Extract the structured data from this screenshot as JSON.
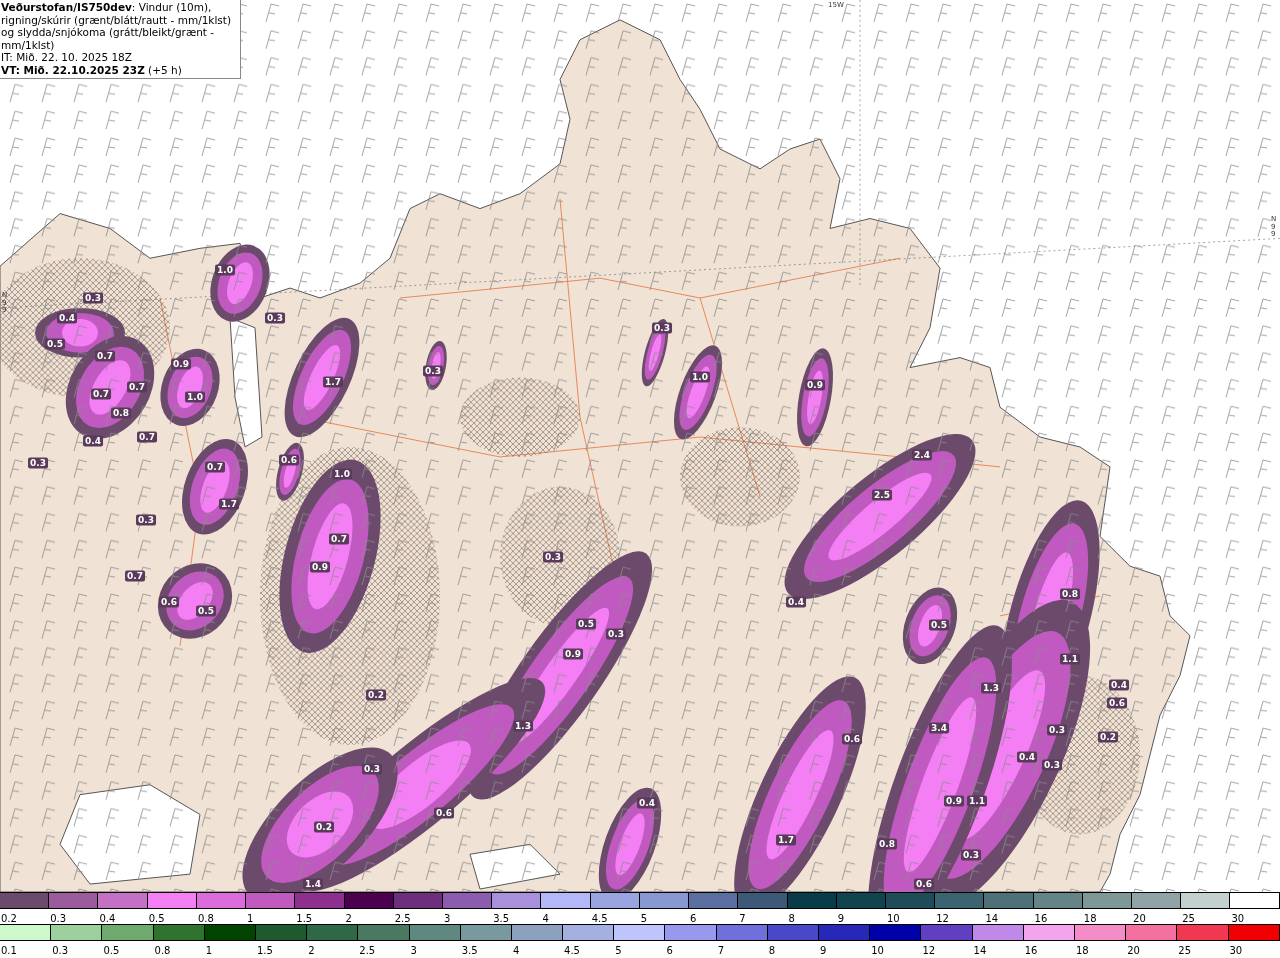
{
  "header": {
    "description": "**Veðurstofan/IS750dev**: Vindur (10m), rigning/skúrir (grænt/blátt/rautt - mm/1klst) og slydda/snjókoma (grátt/bleikt/grænt - mm/1klst)",
    "issue_time": "IT: Mið. 22. 10. 2025 18Z",
    "valid_time": "**VT: Mið. 22.10.2025 23Z** (+5 h)"
  },
  "map": {
    "grid_labels": [
      "15W",
      "N99",
      "N99"
    ],
    "contour_labels": [
      "1.0",
      "0.3",
      "0.4",
      "0.3",
      "0.5",
      "0.7",
      "0.7",
      "0.9",
      "0.7",
      "1.0",
      "0.8",
      "0.7",
      "0.4",
      "0.3",
      "1.7",
      "0.3",
      "0.3",
      "1.0",
      "0.9",
      "0.7",
      "1.7",
      "0.6",
      "1.0",
      "0.3",
      "0.7",
      "0.9",
      "0.3",
      "0.7",
      "0.6",
      "0.5",
      "2.4",
      "2.5",
      "0.4",
      "0.5",
      "0.8",
      "0.5",
      "0.3",
      "0.9",
      "1.1",
      "1.3",
      "0.4",
      "0.6",
      "0.2",
      "1.3",
      "3.4",
      "0.6",
      "0.3",
      "0.2",
      "0.4",
      "0.3",
      "0.3",
      "0.4",
      "0.9",
      "1.1",
      "0.6",
      "0.2",
      "1.7",
      "0.8",
      "0.3",
      "1.4",
      "0.6"
    ]
  },
  "legends": [
    {
      "items": [
        {
          "label": "0.2",
          "color": "#6b4a6b"
        },
        {
          "label": "0.3",
          "color": "#9c5c9c"
        },
        {
          "label": "0.4",
          "color": "#c470c4"
        },
        {
          "label": "0.5",
          "color": "#f47ff4"
        },
        {
          "label": "0.8",
          "color": "#dc6cdc"
        },
        {
          "label": "1",
          "color": "#c05ac0"
        },
        {
          "label": "1.5",
          "color": "#8e2e8e"
        },
        {
          "label": "2",
          "color": "#4e0050"
        },
        {
          "label": "2.5",
          "color": "#6e2e7e"
        },
        {
          "label": "3",
          "color": "#8c5cb0"
        },
        {
          "label": "3.5",
          "color": "#a890dc"
        },
        {
          "label": "4",
          "color": "#b4b8f8"
        },
        {
          "label": "4.5",
          "color": "#9aa4e0"
        },
        {
          "label": "5",
          "color": "#8898d0"
        },
        {
          "label": "6",
          "color": "#5a6ea0"
        },
        {
          "label": "7",
          "color": "#3c5a78"
        },
        {
          "label": "8",
          "color": "#083c48"
        },
        {
          "label": "9",
          "color": "#124450"
        },
        {
          "label": "10",
          "color": "#1e4c58"
        },
        {
          "label": "12",
          "color": "#3a6470"
        },
        {
          "label": "14",
          "color": "#4e7078"
        },
        {
          "label": "16",
          "color": "#648488"
        },
        {
          "label": "18",
          "color": "#7e9898"
        },
        {
          "label": "20",
          "color": "#90a4a8"
        },
        {
          "label": "25",
          "color": "#c4d0d0"
        },
        {
          "label": "30",
          "color": "#ffffff"
        }
      ]
    },
    {
      "items": [
        {
          "label": "0.1",
          "color": "#ccf8cc"
        },
        {
          "label": "0.3",
          "color": "#9cd09c"
        },
        {
          "label": "0.5",
          "color": "#6eaa6e"
        },
        {
          "label": "0.8",
          "color": "#2e742e"
        },
        {
          "label": "1",
          "color": "#004400"
        },
        {
          "label": "1.5",
          "color": "#1e5a2e"
        },
        {
          "label": "2",
          "color": "#2e6846"
        },
        {
          "label": "2.5",
          "color": "#4a7860"
        },
        {
          "label": "3",
          "color": "#5e8880"
        },
        {
          "label": "3.5",
          "color": "#7a98a0"
        },
        {
          "label": "4",
          "color": "#8ca0c0"
        },
        {
          "label": "4.5",
          "color": "#a4b0e0"
        },
        {
          "label": "5",
          "color": "#c0c4fc"
        },
        {
          "label": "6",
          "color": "#9898ec"
        },
        {
          "label": "7",
          "color": "#7070dc"
        },
        {
          "label": "8",
          "color": "#4848c8"
        },
        {
          "label": "9",
          "color": "#2828b8"
        },
        {
          "label": "10",
          "color": "#0000a8"
        },
        {
          "label": "12",
          "color": "#6040c0"
        },
        {
          "label": "14",
          "color": "#c088e8"
        },
        {
          "label": "16",
          "color": "#f4a4ec"
        },
        {
          "label": "18",
          "color": "#f48cc8"
        },
        {
          "label": "20",
          "color": "#f470a0"
        },
        {
          "label": "25",
          "color": "#f03850"
        },
        {
          "label": "30",
          "color": "#f00000"
        }
      ]
    }
  ]
}
